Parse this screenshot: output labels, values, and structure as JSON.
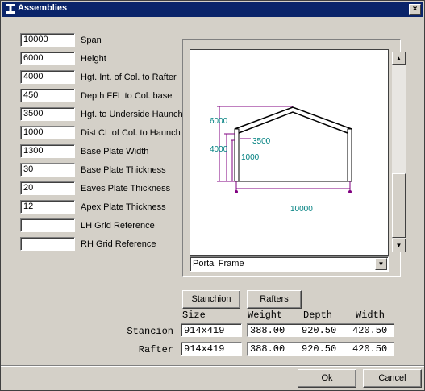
{
  "window": {
    "title": "Assemblies",
    "close_label": "×"
  },
  "fields": [
    {
      "value": "10000",
      "label": "Span"
    },
    {
      "value": "6000",
      "label": "Height"
    },
    {
      "value": "4000",
      "label": "Hgt. Int. of Col. to Rafter"
    },
    {
      "value": "450",
      "label": "Depth FFL to Col. base"
    },
    {
      "value": "3500",
      "label": "Hgt. to Underside Haunch"
    },
    {
      "value": "1000",
      "label": "Dist CL of Col. to Haunch"
    },
    {
      "value": "1300",
      "label": "Base Plate Width"
    },
    {
      "value": "30",
      "label": "Base Plate Thickness"
    },
    {
      "value": "20",
      "label": "Eaves Plate Thickness"
    },
    {
      "value": "12",
      "label": "Apex Plate Thickness"
    },
    {
      "value": "",
      "label": "LH Grid Reference"
    },
    {
      "value": "",
      "label": "RH Grid Reference"
    }
  ],
  "drawing": {
    "dim_height": "6000",
    "dim_col": "4000",
    "dim_haunch": "3500",
    "dim_haunch_dist": "1000",
    "dim_span": "10000",
    "colors": {
      "frame": "#000000",
      "dims": "#800080",
      "text": "#008080"
    }
  },
  "frame_type": {
    "selected": "Portal Frame"
  },
  "section_buttons": {
    "stanchion": "Stanchion",
    "rafters": "Rafters"
  },
  "table": {
    "headers": [
      "Size",
      "Weight",
      "Depth",
      "Width"
    ],
    "rows": [
      {
        "label": "Stancion",
        "size": "914x419",
        "weight": "388.00",
        "depth": "920.50",
        "width": "420.50"
      },
      {
        "label": "Rafter",
        "size": "914x419",
        "weight": "388.00",
        "depth": "920.50",
        "width": "420.50"
      }
    ]
  },
  "footer": {
    "ok": "Ok",
    "cancel": "Cancel"
  }
}
